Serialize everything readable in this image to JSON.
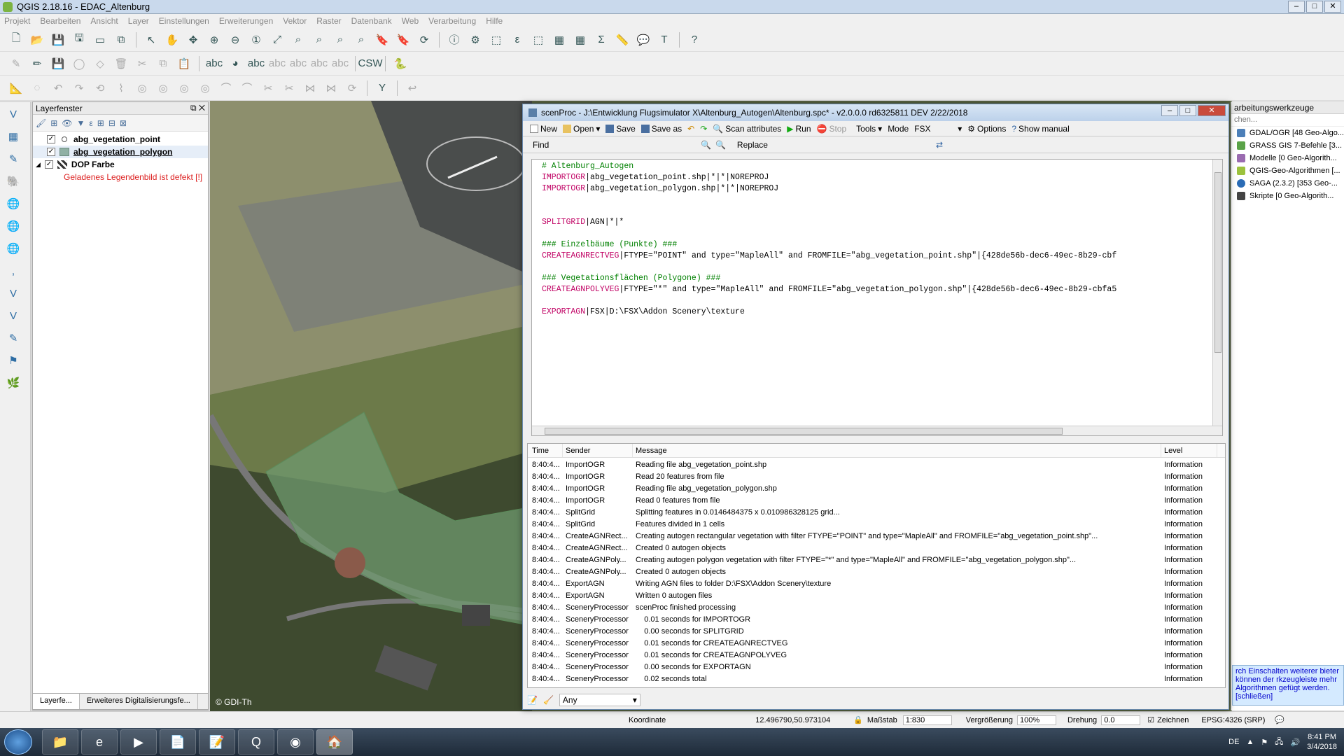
{
  "qgis": {
    "title": "QGIS 2.18.16 - EDAC_Altenburg",
    "menu": [
      "Projekt",
      "Bearbeiten",
      "Ansicht",
      "Layer",
      "Einstellungen",
      "Erweiterungen",
      "Vektor",
      "Raster",
      "Datenbank",
      "Web",
      "Verarbeitung",
      "Hilfe"
    ],
    "layer_panel": {
      "title": "Layerfenster",
      "layers": [
        "abg_vegetation_point",
        "abg_vegetation_polygon",
        "DOP Farbe"
      ],
      "error": "Geladenes Legendenbild ist defekt [!]",
      "tabs": [
        "Layerfe...",
        "Erweiteres Digitalisierungsfe..."
      ]
    },
    "copyright": "© GDI-Th",
    "proc_panel": {
      "title": "arbeitungswerkzeuge",
      "search": "chen...",
      "providers": [
        "GDAL/OGR [48 Geo-Algo...",
        "GRASS GIS 7-Befehle [3...",
        "Modelle [0 Geo-Algorith...",
        "QGIS-Geo-Algorithmen [...",
        "SAGA (2.3.2) [353 Geo-...",
        "Skripte [0 Geo-Algorith..."
      ],
      "notice": "rch Einschalten weiterer bieter können der rkzeugleiste mehr Algorithmen gefügt werden. [schließen]"
    },
    "status": {
      "coord_label": "Koordinate",
      "coord": "12.496790,50.973104",
      "scale_label": "Maßstab",
      "scale": "1:830",
      "mag_label": "Vergrößerung",
      "mag": "100%",
      "rot_label": "Drehung",
      "rot": "0.0",
      "render": "Zeichnen",
      "crs": "EPSG:4326 (SRP)"
    }
  },
  "taskbar": {
    "lang": "DE",
    "time": "8:41 PM",
    "date": "3/4/2018"
  },
  "scenproc": {
    "title": "scenProc - J:\\Entwicklung Flugsimulator X\\Altenburg_Autogen\\Altenburg.spc* - v2.0.0.0 rd6325811 DEV 2/22/2018",
    "toolbar": [
      "New",
      "Open",
      "Save",
      "Save as",
      "Scan attributes",
      "Run",
      "Stop",
      "Tools",
      "Mode",
      "FSX",
      "Options",
      "Show manual"
    ],
    "find": "Find",
    "replace": "Replace",
    "code": [
      {
        "k": "",
        "t": "# Altenburg_Autogen",
        "c": true
      },
      {
        "k": "IMPORTOGR",
        "t": "|abg_vegetation_point.shp|*|*|NOREPROJ"
      },
      {
        "k": "IMPORTOGR",
        "t": "|abg_vegetation_polygon.shp|*|*|NOREPROJ"
      },
      {
        "k": "",
        "t": ""
      },
      {
        "k": "",
        "t": ""
      },
      {
        "k": "SPLITGRID",
        "t": "|AGN|*|*"
      },
      {
        "k": "",
        "t": ""
      },
      {
        "k": "",
        "t": "### Einzelbäume (Punkte) ###",
        "c": true
      },
      {
        "k": "CREATEAGNRECTVEG",
        "t": "|FTYPE=\"POINT\" and type=\"MapleAll\" and FROMFILE=\"abg_vegetation_point.shp\"|{428de56b-dec6-49ec-8b29-cbf"
      },
      {
        "k": "",
        "t": ""
      },
      {
        "k": "",
        "t": "### Vegetationsflächen (Polygone) ###",
        "c": true
      },
      {
        "k": "CREATEAGNPOLYVEG",
        "t": "|FTYPE=\"*\" and type=\"MapleAll\" and FROMFILE=\"abg_vegetation_polygon.shp\"|{428de56b-dec6-49ec-8b29-cbfa5"
      },
      {
        "k": "",
        "t": ""
      },
      {
        "k": "EXPORTAGN",
        "t": "|FSX|D:\\FSX\\Addon Scenery\\texture"
      }
    ],
    "log_headers": [
      "Time",
      "Sender",
      "Message",
      "Level"
    ],
    "log": [
      [
        "8:40:4...",
        "ImportOGR",
        "Reading file abg_vegetation_point.shp",
        "Information"
      ],
      [
        "8:40:4...",
        "ImportOGR",
        "Read 20 features from file",
        "Information"
      ],
      [
        "8:40:4...",
        "ImportOGR",
        "Reading file abg_vegetation_polygon.shp",
        "Information"
      ],
      [
        "8:40:4...",
        "ImportOGR",
        "Read 0 features from file",
        "Information"
      ],
      [
        "8:40:4...",
        "SplitGrid",
        "Splitting features in 0.0146484375 x 0.010986328125 grid...",
        "Information"
      ],
      [
        "8:40:4...",
        "SplitGrid",
        "Features divided in 1 cells",
        "Information"
      ],
      [
        "8:40:4...",
        "CreateAGNRect...",
        "Creating autogen rectangular vegetation with filter FTYPE=\"POINT\" and type=\"MapleAll\" and FROMFILE=\"abg_vegetation_point.shp\"...",
        "Information"
      ],
      [
        "8:40:4...",
        "CreateAGNRect...",
        "Created 0 autogen objects",
        "Information"
      ],
      [
        "8:40:4...",
        "CreateAGNPoly...",
        "Creating autogen polygon vegetation with filter FTYPE=\"*\" and type=\"MapleAll\" and FROMFILE=\"abg_vegetation_polygon.shp\"...",
        "Information"
      ],
      [
        "8:40:4...",
        "CreateAGNPoly...",
        "Created 0 autogen objects",
        "Information"
      ],
      [
        "8:40:4...",
        "ExportAGN",
        "Writing AGN files to folder D:\\FSX\\Addon Scenery\\texture",
        "Information"
      ],
      [
        "8:40:4...",
        "ExportAGN",
        "Written 0 autogen files",
        "Information"
      ],
      [
        "8:40:4...",
        "SceneryProcessor",
        "scenProc finished processing",
        "Information"
      ],
      [
        "8:40:4...",
        "SceneryProcessor",
        "    0.01 seconds for IMPORTOGR",
        "Information"
      ],
      [
        "8:40:4...",
        "SceneryProcessor",
        "    0.00 seconds for SPLITGRID",
        "Information"
      ],
      [
        "8:40:4...",
        "SceneryProcessor",
        "    0.01 seconds for CREATEAGNRECTVEG",
        "Information"
      ],
      [
        "8:40:4...",
        "SceneryProcessor",
        "    0.01 seconds for CREATEAGNPOLYVEG",
        "Information"
      ],
      [
        "8:40:4...",
        "SceneryProcessor",
        "    0.00 seconds for EXPORTAGN",
        "Information"
      ],
      [
        "8:40:4...",
        "SceneryProcessor",
        "    0.02 seconds total",
        "Information"
      ]
    ],
    "filter": "Any"
  }
}
